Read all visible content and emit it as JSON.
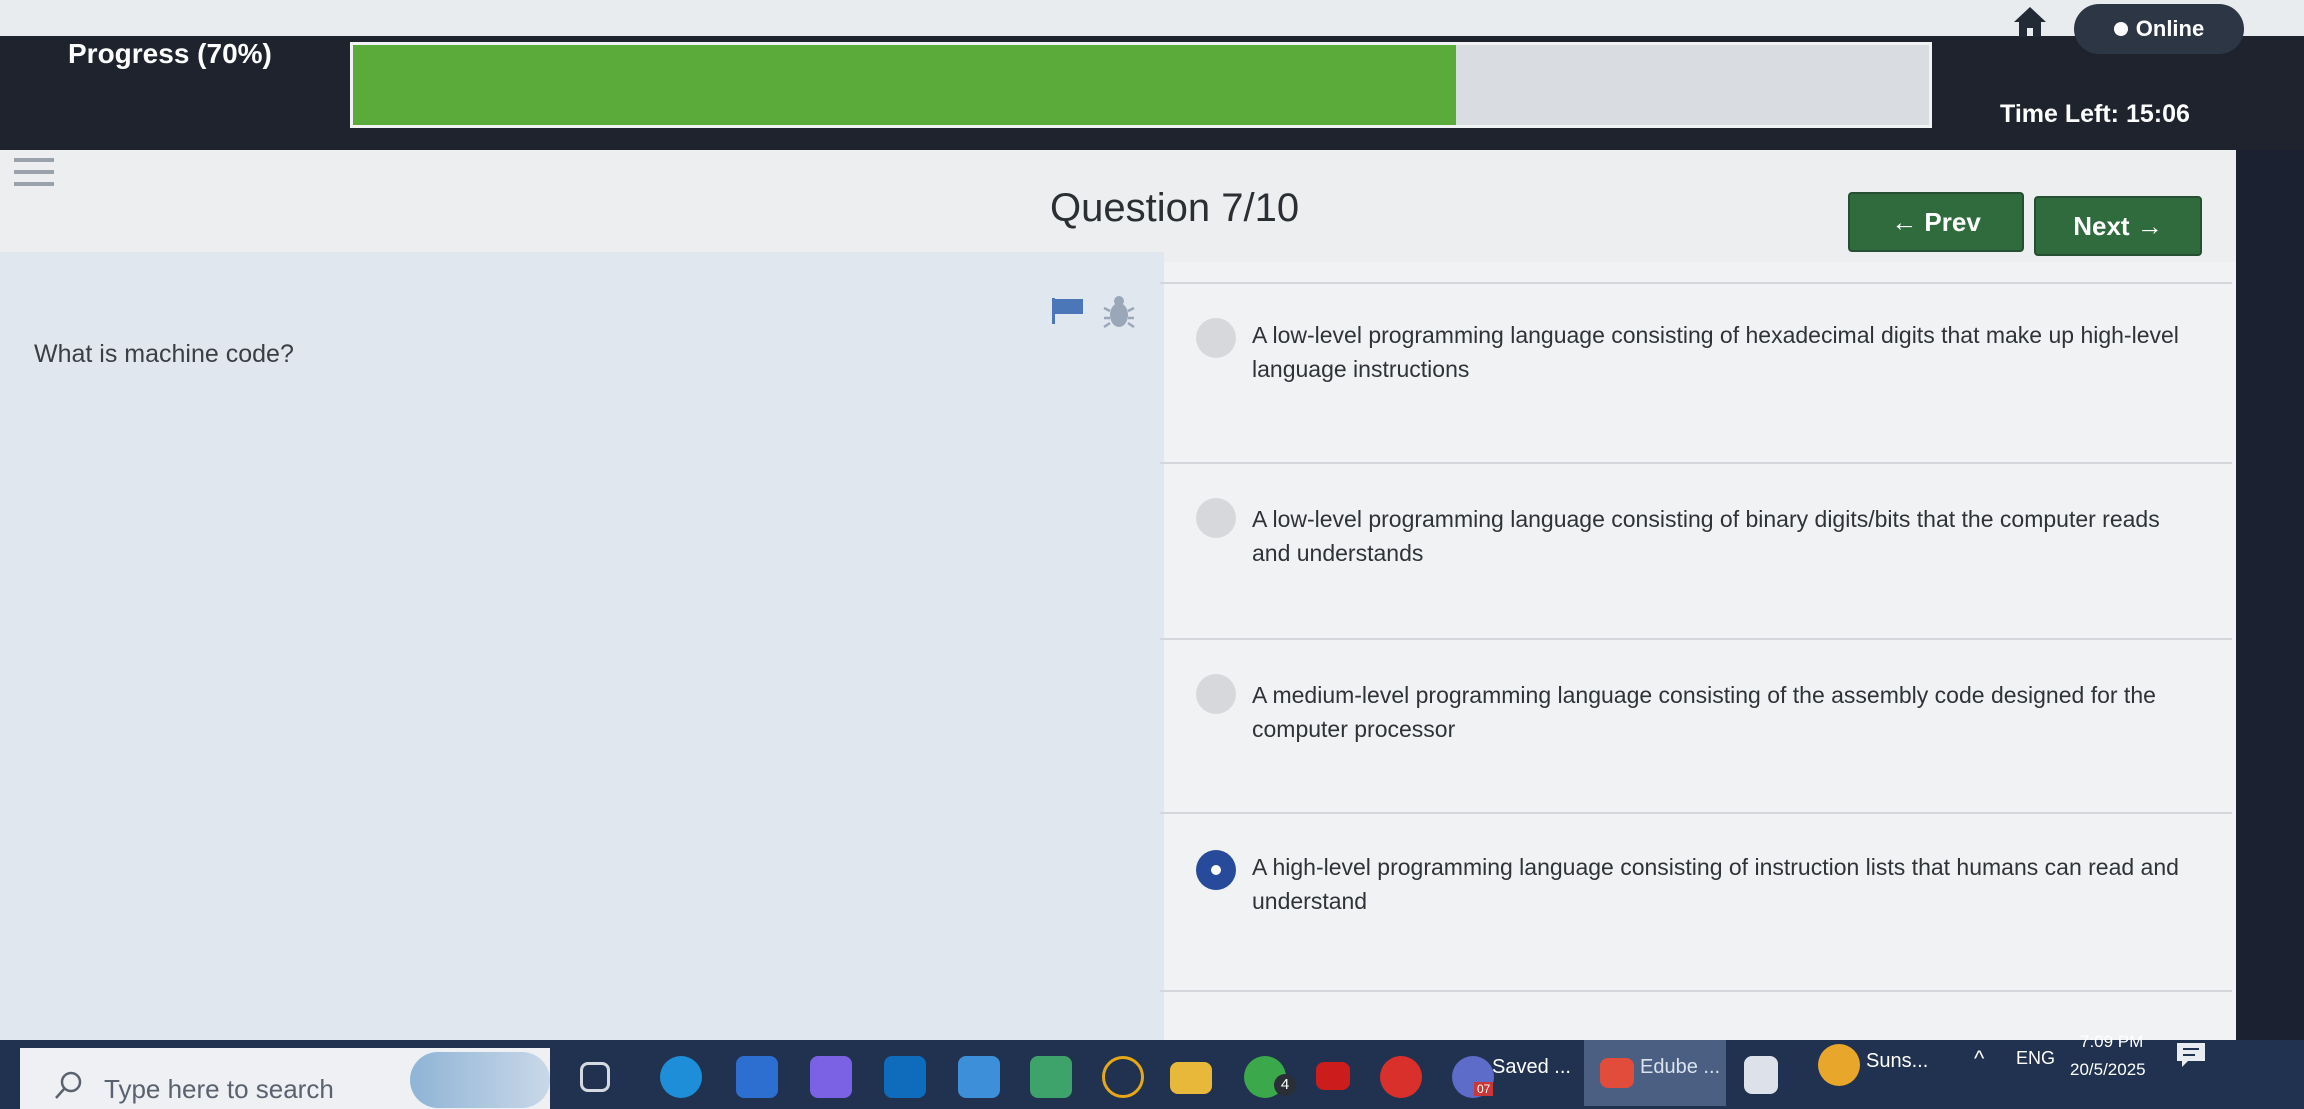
{
  "header": {
    "progress_label": "Progress (70%)",
    "progress_percent": 70,
    "status_label": "Online",
    "time_left": "Time Left: 15:06"
  },
  "quiz": {
    "title": "Question 7/10",
    "prev_label": "← Prev",
    "next_label": "Next →",
    "question": "What is machine code?",
    "answers": [
      {
        "text": "A low-level programming language consisting of hexadecimal digits that make up high-level language instructions",
        "selected": false
      },
      {
        "text": "A low-level programming language consisting of binary digits/bits that the computer reads and understands",
        "selected": false
      },
      {
        "text": "A medium-level programming language consisting of the assembly code designed for the computer processor",
        "selected": false
      },
      {
        "text": "A high-level programming language consisting of instruction lists that humans can read and understand",
        "selected": true
      }
    ]
  },
  "taskbar": {
    "search_placeholder": "Type here to search",
    "items": [
      {
        "icon": "task-view-icon",
        "label": ""
      },
      {
        "icon": "edge-icon",
        "label": ""
      },
      {
        "icon": "store-icon",
        "label": ""
      },
      {
        "icon": "copilot-icon",
        "label": ""
      },
      {
        "icon": "outlook-icon",
        "label": ""
      },
      {
        "icon": "teams-icon",
        "label": ""
      },
      {
        "icon": "gif-icon",
        "label": ""
      },
      {
        "icon": "media-icon",
        "label": ""
      },
      {
        "icon": "file-explorer-icon",
        "label": ""
      },
      {
        "icon": "whatsapp-icon",
        "label": ""
      },
      {
        "icon": "youtube-icon",
        "label": ""
      },
      {
        "icon": "wps-icon",
        "label": ""
      }
    ],
    "saved_label": "Saved ...",
    "edge_label": "Edube ...",
    "weather_label": "Suns...",
    "whatsapp_badge": "4",
    "saved_badge": "07",
    "language": "ENG",
    "time": "7:09 PM",
    "date": "20/5/2025",
    "colors": {
      "accent_green": "#5aab3a",
      "button_green": "#2f6b3d",
      "selected_radio": "#274a9a"
    }
  }
}
